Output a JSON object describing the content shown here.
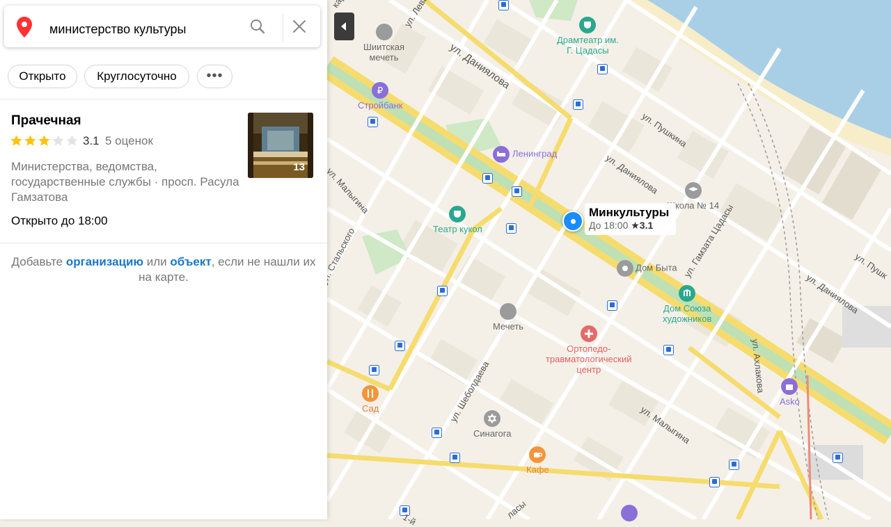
{
  "search": {
    "query": "министерство культуры"
  },
  "filters": {
    "open": "Открыто",
    "around_the_clock": "Круглосуточно",
    "more": "•••"
  },
  "result": {
    "title": "Прачечная",
    "rating": "3.1",
    "rating_stars": 3,
    "rating_count": "5 оценок",
    "description": "Министерства, ведомства, государственные службы · просп. Расула Гамзатова",
    "hours": "Открыто до 18:00",
    "photo_count": "13"
  },
  "add_hint": {
    "prefix": "Добавьте",
    "link_org": "организацию",
    "middle": "или",
    "link_obj": "объект",
    "suffix": ", если не нашли их на карте."
  },
  "map": {
    "marker": {
      "name": "Минкультуры",
      "hours": "До 18:00",
      "rating": "★3.1"
    },
    "pois": {
      "mosque_shiite_1": "Шиитская",
      "mosque_shiite_2": "мечеть",
      "drama_1": "Драмтеатр им.",
      "drama_2": "Г. Цадасы",
      "stroybank": "Стройбанк",
      "leningrad": "Ленинград",
      "school": "Школа № 14",
      "puppet": "Театр кукол",
      "dom_byta": "Дом Быта",
      "artists_1": "Дом Союза",
      "artists_2": "художников",
      "mosque": "Мечеть",
      "ortho_1": "Ортопедо-",
      "ortho_2": "травматологический",
      "ortho_3": "центр",
      "sad": "Сад",
      "asko": "Asko",
      "synagogue": "Синагога",
      "cafe": "Кафе"
    },
    "streets": {
      "daniyalova_1": "ул. Даниялова",
      "daniyalova_2": "ул. Даниялова",
      "daniyalova_3": "ул. Даниялова",
      "pushkina_1": "ул. Пушкина",
      "pushkina_2": "ул. Пушк",
      "malygina_1": "ул. Малыгина",
      "malygina_2": "ул. Малыгина",
      "gamzata": "ул. Гамзата Цадасы",
      "stalskogo": "ул. Стальского",
      "akhlakova": "ул. Ахлакова",
      "sheboldaeva": "ул. Шеболдаева",
      "levan": "ул. Лева",
      "kara": "кара",
      "edge": "1-й",
      "edge2": "ласы"
    }
  },
  "colors": {
    "link": "#1a77c8",
    "marker": "#1a8cff",
    "star": "#fcc30b",
    "poi_green": "#2aa88d",
    "poi_purple": "#8a6fd8",
    "poi_orange": "#f5943a",
    "poi_red": "#e56a6a"
  }
}
